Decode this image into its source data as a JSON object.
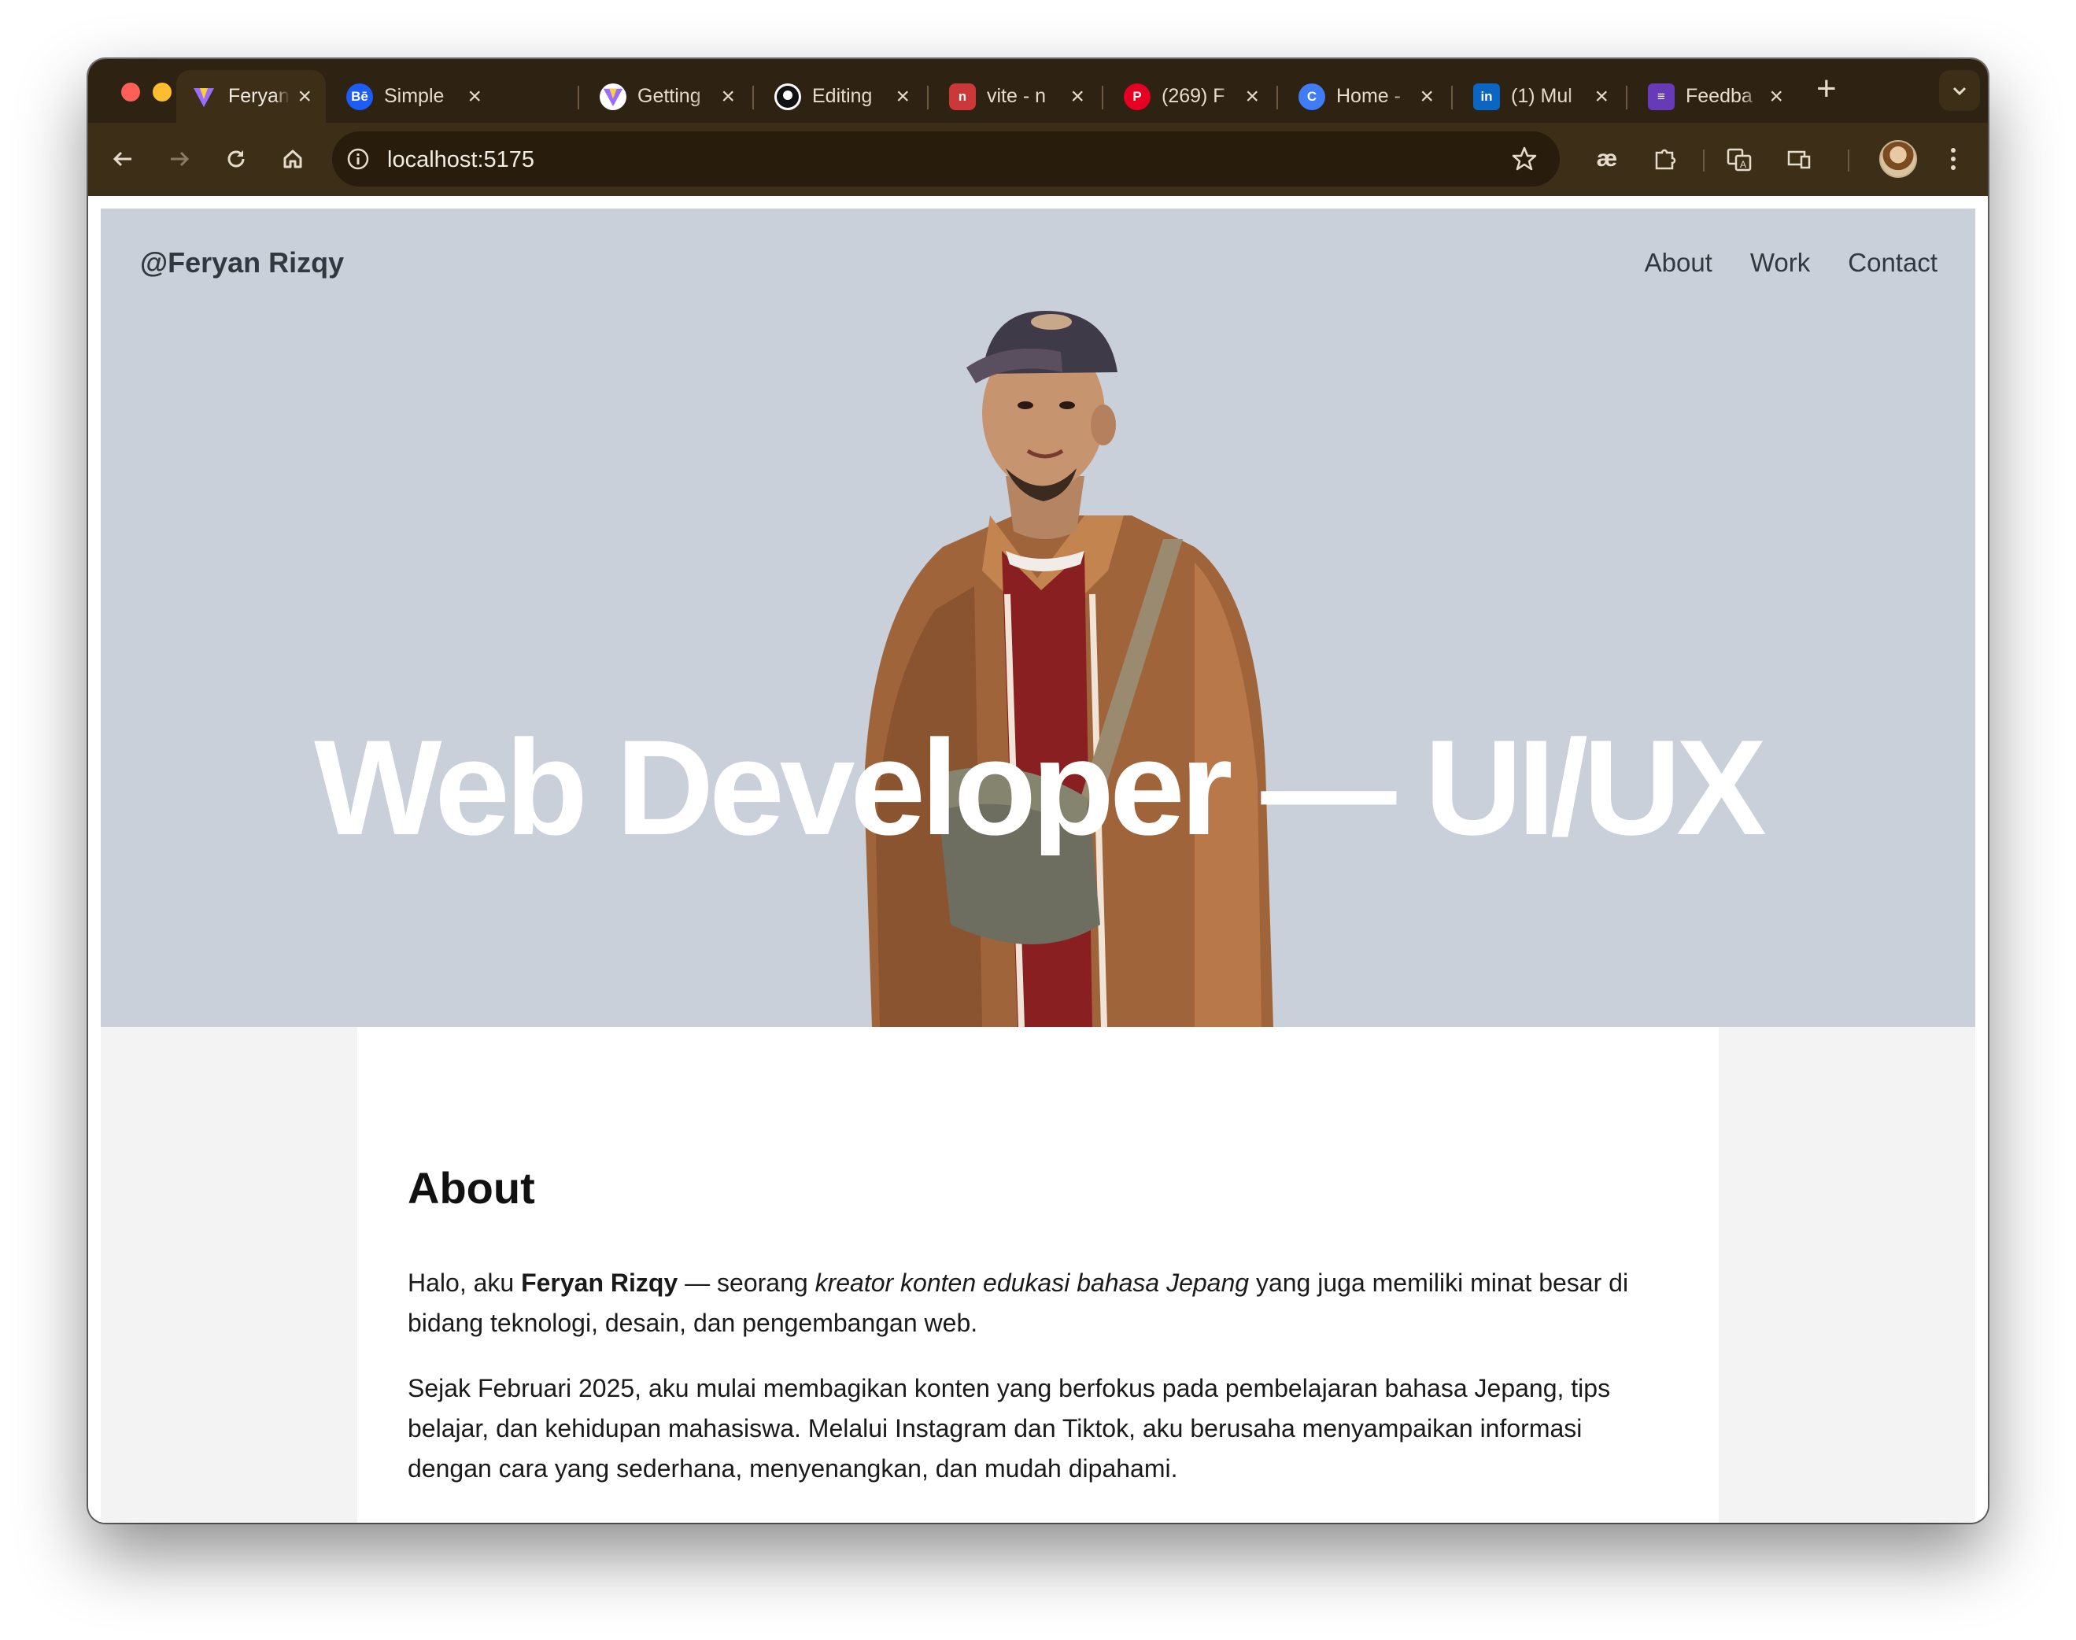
{
  "browser": {
    "tabs": [
      {
        "title": "Feryan",
        "favicon": "vite-icon",
        "active": true
      },
      {
        "title": "Simple",
        "favicon": "behance-icon"
      },
      {
        "title": "Getting",
        "favicon": "vite-icon"
      },
      {
        "title": "Editing",
        "favicon": "github-icon"
      },
      {
        "title": "vite - n",
        "favicon": "npm-icon"
      },
      {
        "title": "(269) F",
        "favicon": "pinterest-icon"
      },
      {
        "title": "Home -",
        "favicon": "canva-icon"
      },
      {
        "title": "(1) Mul",
        "favicon": "linkedin-icon"
      },
      {
        "title": "Feedba",
        "favicon": "forms-icon"
      }
    ],
    "new_tab_label": "+",
    "url": "localhost:5175"
  },
  "site": {
    "brand": "@Feryan Rizqy",
    "nav": [
      "About",
      "Work",
      "Contact"
    ],
    "hero_title": "Web Developer — UI/UX"
  },
  "about": {
    "heading": "About",
    "p1": {
      "prefix": "Halo, aku ",
      "name": "Feryan Rizqy",
      "middle": " — seorang ",
      "emphasis": "kreator konten edukasi bahasa Jepang",
      "suffix": " yang juga memiliki minat besar di bidang teknologi, desain, dan pengembangan web."
    },
    "p2": "Sejak Februari 2025, aku mulai membagikan konten yang berfokus pada pembelajaran bahasa Jepang, tips belajar, dan kehidupan mahasiswa. Melalui Instagram dan Tiktok, aku berusaha menyampaikan informasi dengan cara yang sederhana, menyenangkan, dan mudah dipahami."
  },
  "colors": {
    "tabstrip": "#2e2212",
    "toolbar": "#3d2e18",
    "hero_bg": "#c9d0d9",
    "page_bg": "#f3f3f3"
  }
}
